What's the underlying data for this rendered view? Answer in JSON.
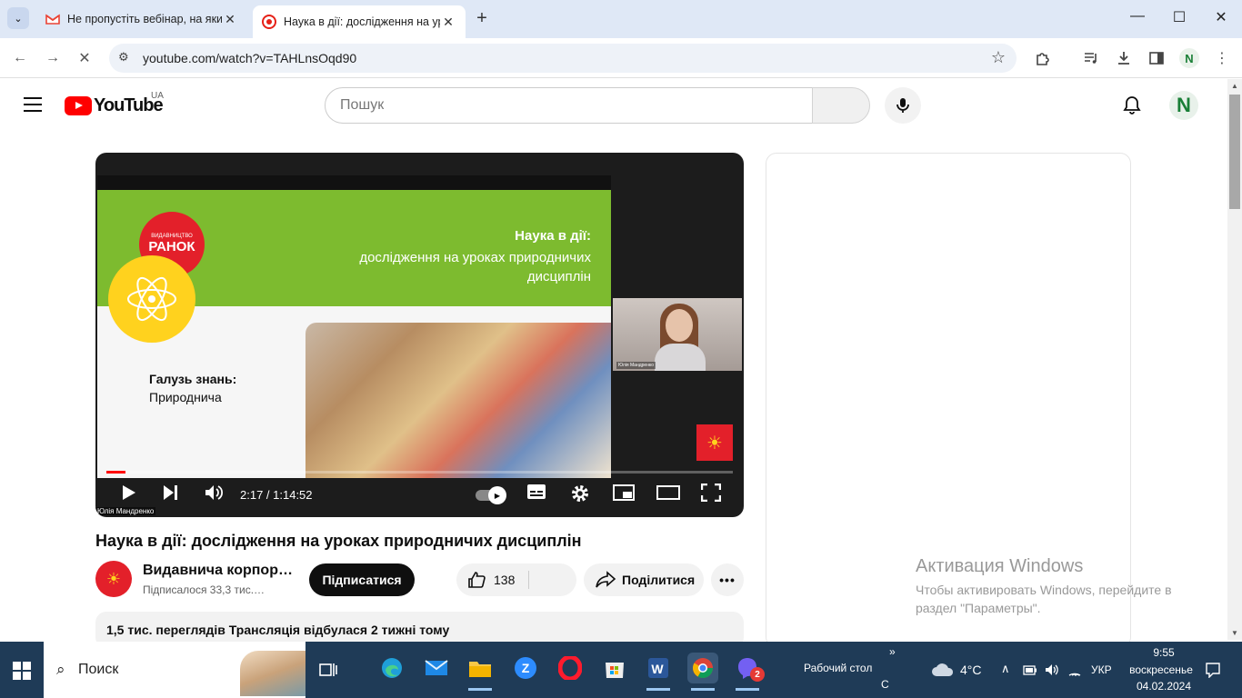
{
  "browser": {
    "tabs": [
      {
        "title": "Не пропустіть вебінар, на яки",
        "favicon": "gmail-icon"
      },
      {
        "title": "Наука в дії: дослідження на ур",
        "favicon": "youtube-live-icon"
      }
    ],
    "url": "youtube.com/watch?v=TAHLnsOqd90",
    "profile_initial": "N"
  },
  "youtube": {
    "region": "UA",
    "logo_text": "YouTube",
    "search_placeholder": "Пошук",
    "avatar_initial": "N"
  },
  "player": {
    "slide_title": "Наука в дії:",
    "slide_subtitle": "дослідження на уроках природничих дисциплін",
    "publisher_small": "ВИДАВНИЦТВО",
    "publisher_big": "РАНОК",
    "field_heading": "Галузь знань:",
    "field_value": "Природнича",
    "speaker_name": "Юлія Мандренко",
    "cam_label": "Юлія Мандренко",
    "current_time": "2:17",
    "duration": "1:14:52",
    "time_display": "2:17 / 1:14:52",
    "progress_fraction": 0.03
  },
  "video": {
    "title": "Наука в дії: дослідження на уроках природничих дисциплін",
    "channel_name": "Видавнича корпор…",
    "subscribers": "Підписалося 33,3 тис.…",
    "subscribe_label": "Підписатися",
    "likes": "138",
    "share_label": "Поділитися",
    "more_label": "•••",
    "description_stats": "1,5 тис. переглядів  Трансляція відбулася 2 тижні тому"
  },
  "watermark": {
    "title": "Активация Windows",
    "line1": "Чтобы активировать Windows, перейдите в",
    "line2": "раздел \"Параметры\"."
  },
  "taskbar": {
    "search_label": "Поиск",
    "desktop_label": "Рабочий стол",
    "desktop_sub": "С",
    "chevron": "»",
    "weather": "4°C",
    "language": "УКР",
    "time": "9:55",
    "day": "воскресенье",
    "date": "04.02.2024",
    "viber_badge": "2"
  }
}
